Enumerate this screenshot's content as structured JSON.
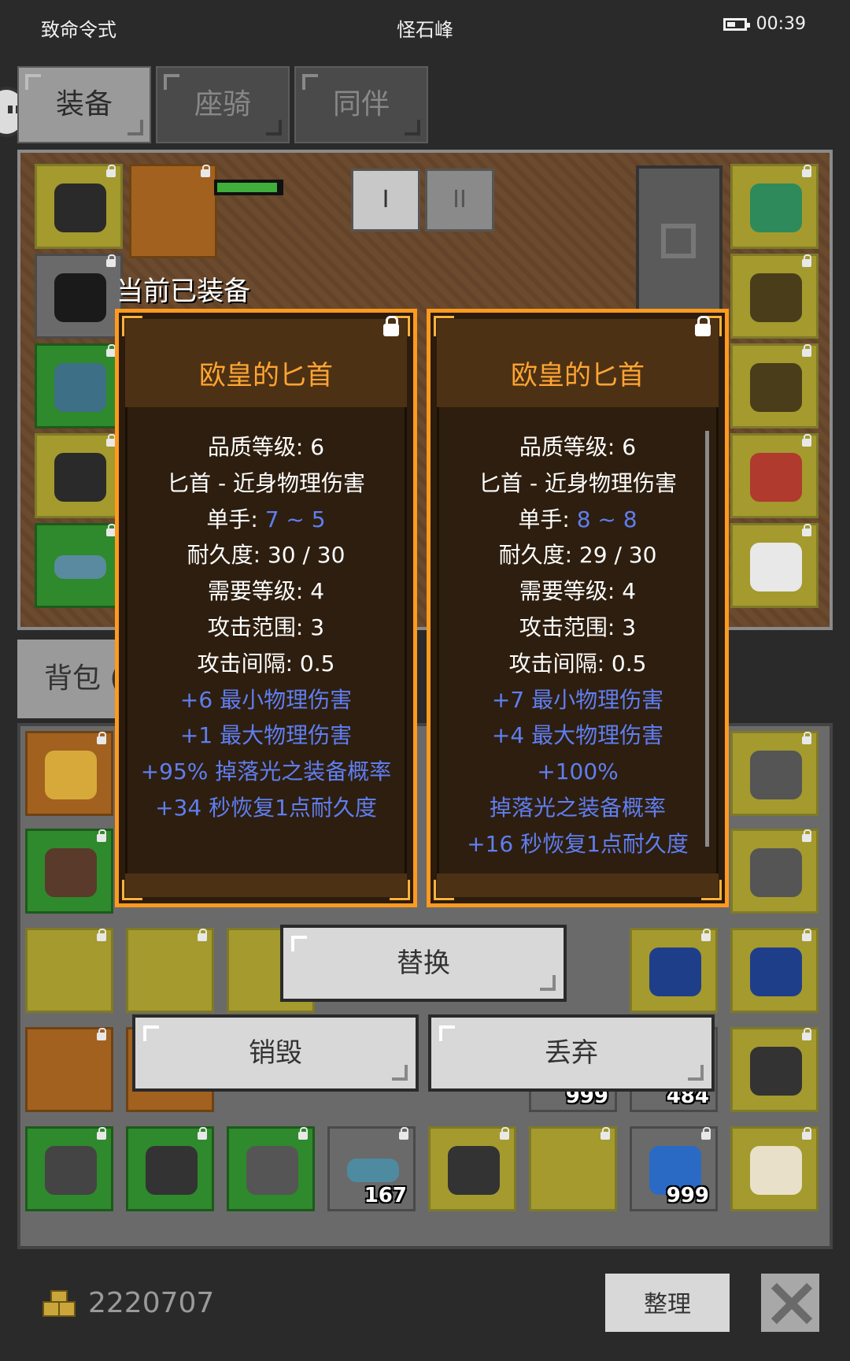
{
  "status_bar": {
    "left_text": "致命令式",
    "center_text": "怪石峰",
    "time": "00:39"
  },
  "tabs": [
    {
      "label": "装备",
      "active": true
    },
    {
      "label": "座骑",
      "active": false
    },
    {
      "label": "同伴",
      "active": false
    }
  ],
  "equip_controls": {
    "btn1": "I",
    "btn2": "II"
  },
  "backpack_tab": "背包 (",
  "current_equipped_label": "当前已装备",
  "cards": [
    {
      "title": "欧皇的匕首",
      "stats": [
        {
          "text": "品质等级: 6",
          "color": "white"
        },
        {
          "text": "匕首 - 近身物理伤害",
          "color": "white"
        },
        {
          "prefix": "单手: ",
          "value": "7 ~ 5"
        },
        {
          "text": "耐久度: 30 / 30",
          "color": "white"
        },
        {
          "text": "需要等级: 4",
          "color": "white"
        },
        {
          "text": "攻击范围: 3",
          "color": "white"
        },
        {
          "text": "攻击间隔: 0.5",
          "color": "white"
        },
        {
          "text": "+6 最小物理伤害",
          "color": "blue"
        },
        {
          "text": "+1 最大物理伤害",
          "color": "blue"
        },
        {
          "text": "+95% 掉落光之装备概率",
          "color": "blue"
        },
        {
          "text": "+34 秒恢复1点耐久度",
          "color": "blue"
        }
      ]
    },
    {
      "title": "欧皇的匕首",
      "stats": [
        {
          "text": "品质等级: 6",
          "color": "white"
        },
        {
          "text": "匕首 - 近身物理伤害",
          "color": "white"
        },
        {
          "prefix": "单手: ",
          "value": "8 ~ 8"
        },
        {
          "text": "耐久度: 29 / 30",
          "color": "white"
        },
        {
          "text": "需要等级: 4",
          "color": "white"
        },
        {
          "text": "攻击范围: 3",
          "color": "white"
        },
        {
          "text": "攻击间隔: 0.5",
          "color": "white"
        },
        {
          "text": "+7 最小物理伤害",
          "color": "blue"
        },
        {
          "text": "+4 最大物理伤害",
          "color": "blue"
        },
        {
          "text": "+100%",
          "color": "blue"
        },
        {
          "text": "掉落光之装备概率",
          "color": "blue"
        },
        {
          "text": "+16 秒恢复1点耐久度",
          "color": "blue"
        }
      ]
    }
  ],
  "actions": {
    "replace": "替换",
    "destroy": "销毁",
    "discard": "丢弃"
  },
  "item_counts": [
    "999",
    "484",
    "167",
    "999"
  ],
  "gold": "2220707",
  "sort_button": "整理",
  "colors": {
    "title": "#ffa533",
    "stat_blue": "#5f7ef0",
    "card_border": "#ff9a1f"
  }
}
